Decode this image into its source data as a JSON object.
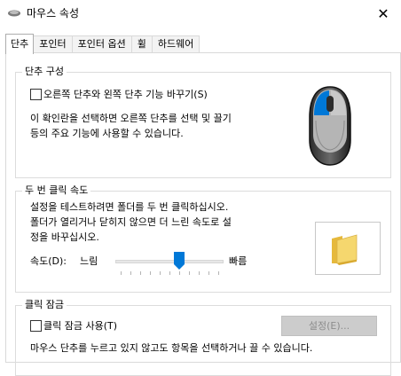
{
  "window": {
    "title": "마우스 속성",
    "close_glyph": "✕"
  },
  "tabs": [
    {
      "label": "단추",
      "active": true
    },
    {
      "label": "포인터",
      "active": false
    },
    {
      "label": "포인터 옵션",
      "active": false
    },
    {
      "label": "휠",
      "active": false
    },
    {
      "label": "하드웨어",
      "active": false
    }
  ],
  "button_config": {
    "title": "단추 구성",
    "swap_checkbox_label": "오른쪽 단추와 왼쪽 단추 기능 바꾸기(S)",
    "swap_checked": false,
    "description_line1": "이 확인란을 선택하면 오른쪽 단추를 선택 및 끌기",
    "description_line2": "등의 주요 기능에 사용할 수 있습니다."
  },
  "double_click": {
    "title": "두 번 클릭 속도",
    "description_line1": "설정을 테스트하려면 폴더를 두 번 클릭하십시오.",
    "description_line2": "폴더가 열리거나 닫히지 않으면 더 느린 속도로 설",
    "description_line3": "정을 바꾸십시오.",
    "speed_label": "속도(D):",
    "slow_label": "느림",
    "fast_label": "빠름",
    "slider_value_fraction": 0.6
  },
  "click_lock": {
    "title": "클릭 잠금",
    "checkbox_label": "클릭 잠금 사용(T)",
    "checked": false,
    "settings_button": "설정(E)...",
    "description_line1": "마우스 단추를 누르고 있지 않고도 항목을 선택하거나 끌 수 있습니다."
  },
  "colors": {
    "accent": "#0078d7",
    "folder": "#f5d76e"
  },
  "icons": {
    "app": "mouse-icon",
    "close": "close-icon",
    "mouse_image": "mouse-image-icon",
    "folder": "folder-icon"
  }
}
